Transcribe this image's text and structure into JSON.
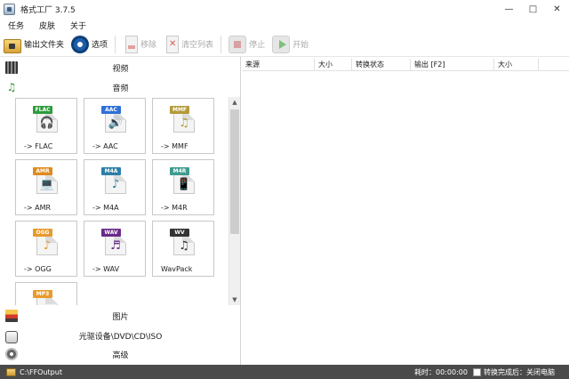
{
  "window": {
    "title": "格式工厂 3.7.5",
    "minimize": "—",
    "maximize": "□",
    "close": "✕"
  },
  "menu": [
    "任务",
    "皮肤",
    "关于"
  ],
  "toolbar": {
    "output_folder": "输出文件夹",
    "options": "选项",
    "remove": "移除",
    "clear_list": "清空列表",
    "stop": "停止",
    "start": "开始"
  },
  "categories": {
    "video": "视频",
    "audio": "音频",
    "picture": "图片",
    "disc": "光驱设备\\DVD\\CD\\ISO",
    "advanced": "高级"
  },
  "audio_formats": [
    {
      "badge": "FLAC",
      "label": "-> FLAC",
      "color": "#2e9b3c",
      "glyph": "🎧"
    },
    {
      "badge": "AAC",
      "label": "-> AAC",
      "color": "#2f6fd6",
      "glyph": "🔊"
    },
    {
      "badge": "MMF",
      "label": "-> MMF",
      "color": "#b59a3a",
      "glyph": "♫"
    },
    {
      "badge": "AMR",
      "label": "-> AMR",
      "color": "#e08a1e",
      "glyph": "💻"
    },
    {
      "badge": "M4A",
      "label": "-> M4A",
      "color": "#2c7fa8",
      "glyph": "♪"
    },
    {
      "badge": "M4R",
      "label": "-> M4R",
      "color": "#3f9a8f",
      "glyph": "📱"
    },
    {
      "badge": "OGG",
      "label": "-> OGG",
      "color": "#e89a2c",
      "glyph": "♪"
    },
    {
      "badge": "WAV",
      "label": "-> WAV",
      "color": "#6a2a8a",
      "glyph": "♬"
    },
    {
      "badge": "WV",
      "label": "WavPack",
      "color": "#333333",
      "glyph": "♫"
    },
    {
      "badge": "MP3",
      "label": "",
      "color": "#e89a2c",
      "glyph": ""
    }
  ],
  "columns": [
    "来源",
    "大小",
    "转换状态",
    "输出 [F2]",
    "大小"
  ],
  "status": {
    "path": "C:\\FFOutput",
    "elapsed": "耗时：00:00:00",
    "after_done": "转换完成后：关闭电脑"
  },
  "colors": {
    "statusbar_bg": "#4a4a4a"
  }
}
